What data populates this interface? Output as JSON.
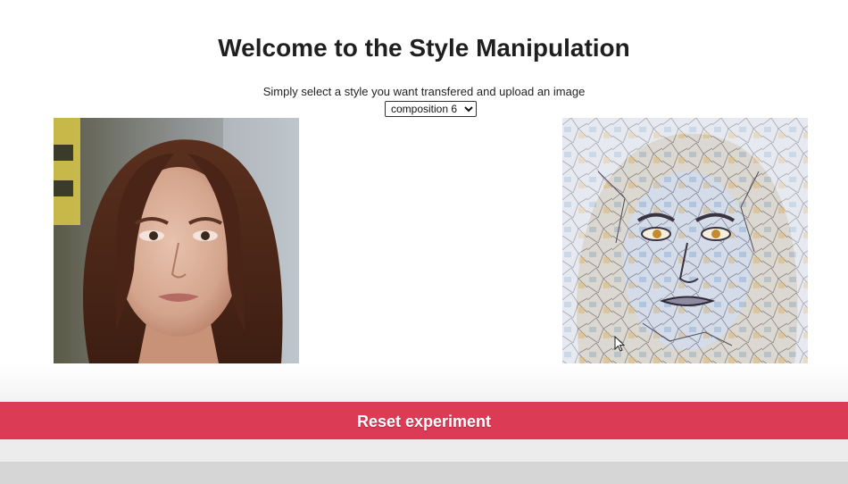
{
  "header": {
    "title": "Welcome to the Style Manipulation",
    "subtitle": "Simply select a style you want transfered and upload an image"
  },
  "style_select": {
    "selected": "composition 6",
    "options": [
      "composition 6"
    ]
  },
  "images": {
    "input": "input-portrait-photo",
    "output": "stylized-portrait-output"
  },
  "reset": {
    "label": "Reset experiment"
  },
  "colors": {
    "accent": "#dc3b56",
    "title": "#1f1f1f",
    "bottom_bar_light": "#ececec",
    "bottom_bar_dark": "#d6d6d6"
  }
}
